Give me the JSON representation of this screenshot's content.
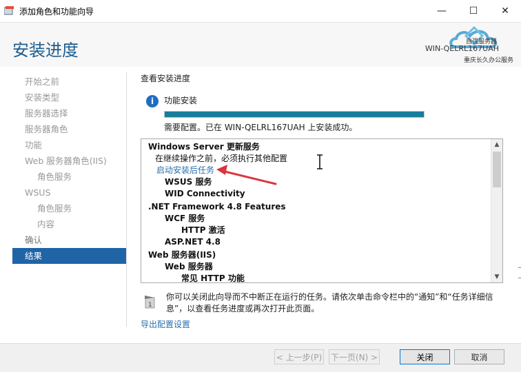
{
  "window": {
    "title": "添加角色和功能向导",
    "minimize_glyph": "—",
    "maximize_glyph": "☐",
    "close_glyph": "✕"
  },
  "header": {
    "page_title": "安装进度",
    "logo_text": "自强服务器",
    "server_name": "WIN-QELRL167UAH",
    "watermark": "重庆长久办公服务"
  },
  "nav": {
    "items": [
      {
        "label": "开始之前",
        "level": 0,
        "state": "disabled"
      },
      {
        "label": "安装类型",
        "level": 0,
        "state": "disabled"
      },
      {
        "label": "服务器选择",
        "level": 0,
        "state": "disabled"
      },
      {
        "label": "服务器角色",
        "level": 0,
        "state": "disabled"
      },
      {
        "label": "功能",
        "level": 0,
        "state": "disabled"
      },
      {
        "label": "Web 服务器角色(IIS)",
        "level": 0,
        "state": "disabled"
      },
      {
        "label": "角色服务",
        "level": 1,
        "state": "disabled"
      },
      {
        "label": "WSUS",
        "level": 0,
        "state": "disabled"
      },
      {
        "label": "角色服务",
        "level": 1,
        "state": "disabled"
      },
      {
        "label": "内容",
        "level": 1,
        "state": "disabled"
      },
      {
        "label": "确认",
        "level": 0,
        "state": "enabled"
      },
      {
        "label": "结果",
        "level": 0,
        "state": "active"
      }
    ]
  },
  "main": {
    "section_title": "查看安装进度",
    "info_icon_glyph": "i",
    "feature_install_label": "功能安装",
    "progress": 1.0,
    "status_text": "需要配置。已在 WIN-QELRL167UAH 上安装成功。",
    "results": [
      {
        "text": "Windows Server 更新服务",
        "kind": "lvl0"
      },
      {
        "text": "在继续操作之前，必须执行其他配置",
        "kind": "lvl1"
      },
      {
        "text": "启动安装后任务",
        "kind": "link"
      },
      {
        "text": "WSUS 服务",
        "kind": "lvl1b"
      },
      {
        "text": "WID Connectivity",
        "kind": "lvl1b"
      },
      {
        "text": ".NET Framework 4.8 Features",
        "kind": "lvl0"
      },
      {
        "text": "WCF 服务",
        "kind": "lvl1b"
      },
      {
        "text": "HTTP 激活",
        "kind": "lvl2"
      },
      {
        "text": "ASP.NET 4.8",
        "kind": "lvl1b"
      },
      {
        "text": "Web 服务器(IIS)",
        "kind": "lvl0"
      },
      {
        "text": "Web 服务器",
        "kind": "lvl1b"
      },
      {
        "text": "常见 HTTP 功能",
        "kind": "lvl2"
      }
    ],
    "notice_text": "你可以关闭此向导而不中断正在运行的任务。请依次单击命令栏中的“通知”和“任务详细信息”，以查看任务进度或再次打开此页面。",
    "export_link": "导出配置设置"
  },
  "footer": {
    "prev_label": "< 上一步(P)",
    "next_label": "下一页(N) >",
    "close_label": "关闭",
    "cancel_label": "取消"
  },
  "colors": {
    "accent": "#1f64a6",
    "title_blue": "#1d5d8e",
    "progress_fill": "#167e9b",
    "link": "#2c6fae",
    "annotation_arrow": "#d9363e"
  },
  "icons": [
    "wizard-app-icon",
    "info-icon",
    "flag-icon",
    "cloud-logo-icon",
    "mouse-cursor-icon",
    "chevron-up-icon",
    "chevron-down-icon"
  ]
}
